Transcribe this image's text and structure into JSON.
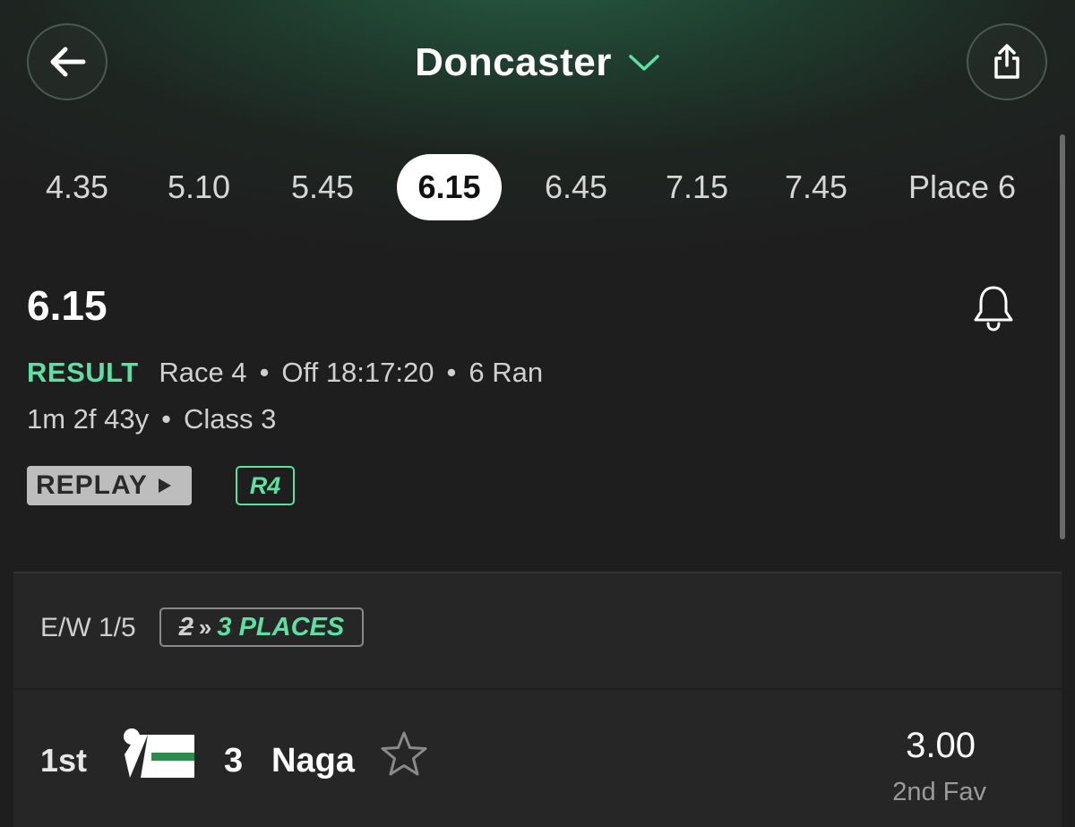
{
  "header": {
    "title": "Doncaster",
    "back_icon": "arrow-left-icon",
    "dropdown_icon": "chevron-down-icon",
    "share_icon": "share-icon"
  },
  "race_tabs": [
    "4.35",
    "5.10",
    "5.45",
    "6.15",
    "6.45",
    "7.15",
    "7.45",
    "Place 6"
  ],
  "active_tab": "6.15",
  "race": {
    "title": "6.15",
    "status": "RESULT",
    "race_number": "Race 4",
    "off_time": "Off 18:17:20",
    "runners": "6 Ran",
    "distance": "1m 2f 43y",
    "class": "Class 3",
    "replay_label": "REPLAY",
    "race_badge": "R4",
    "bell_icon": "bell-icon"
  },
  "market": {
    "each_way": "E/W 1/5",
    "places_old": "2",
    "places_arrows": "»",
    "places_new": "3 PLACES"
  },
  "runners": [
    {
      "position": "1st",
      "number": "3",
      "name": "Naga",
      "odds": "3.00",
      "fav_label": "2nd Fav",
      "silk_icon": "jockey-silk-icon",
      "star_icon": "star-outline-icon"
    }
  ],
  "colors": {
    "accent_green": "#5fe0a2",
    "background": "#1e1e1e",
    "card": "#262626",
    "silk_stripe": "#2e8b4e"
  }
}
